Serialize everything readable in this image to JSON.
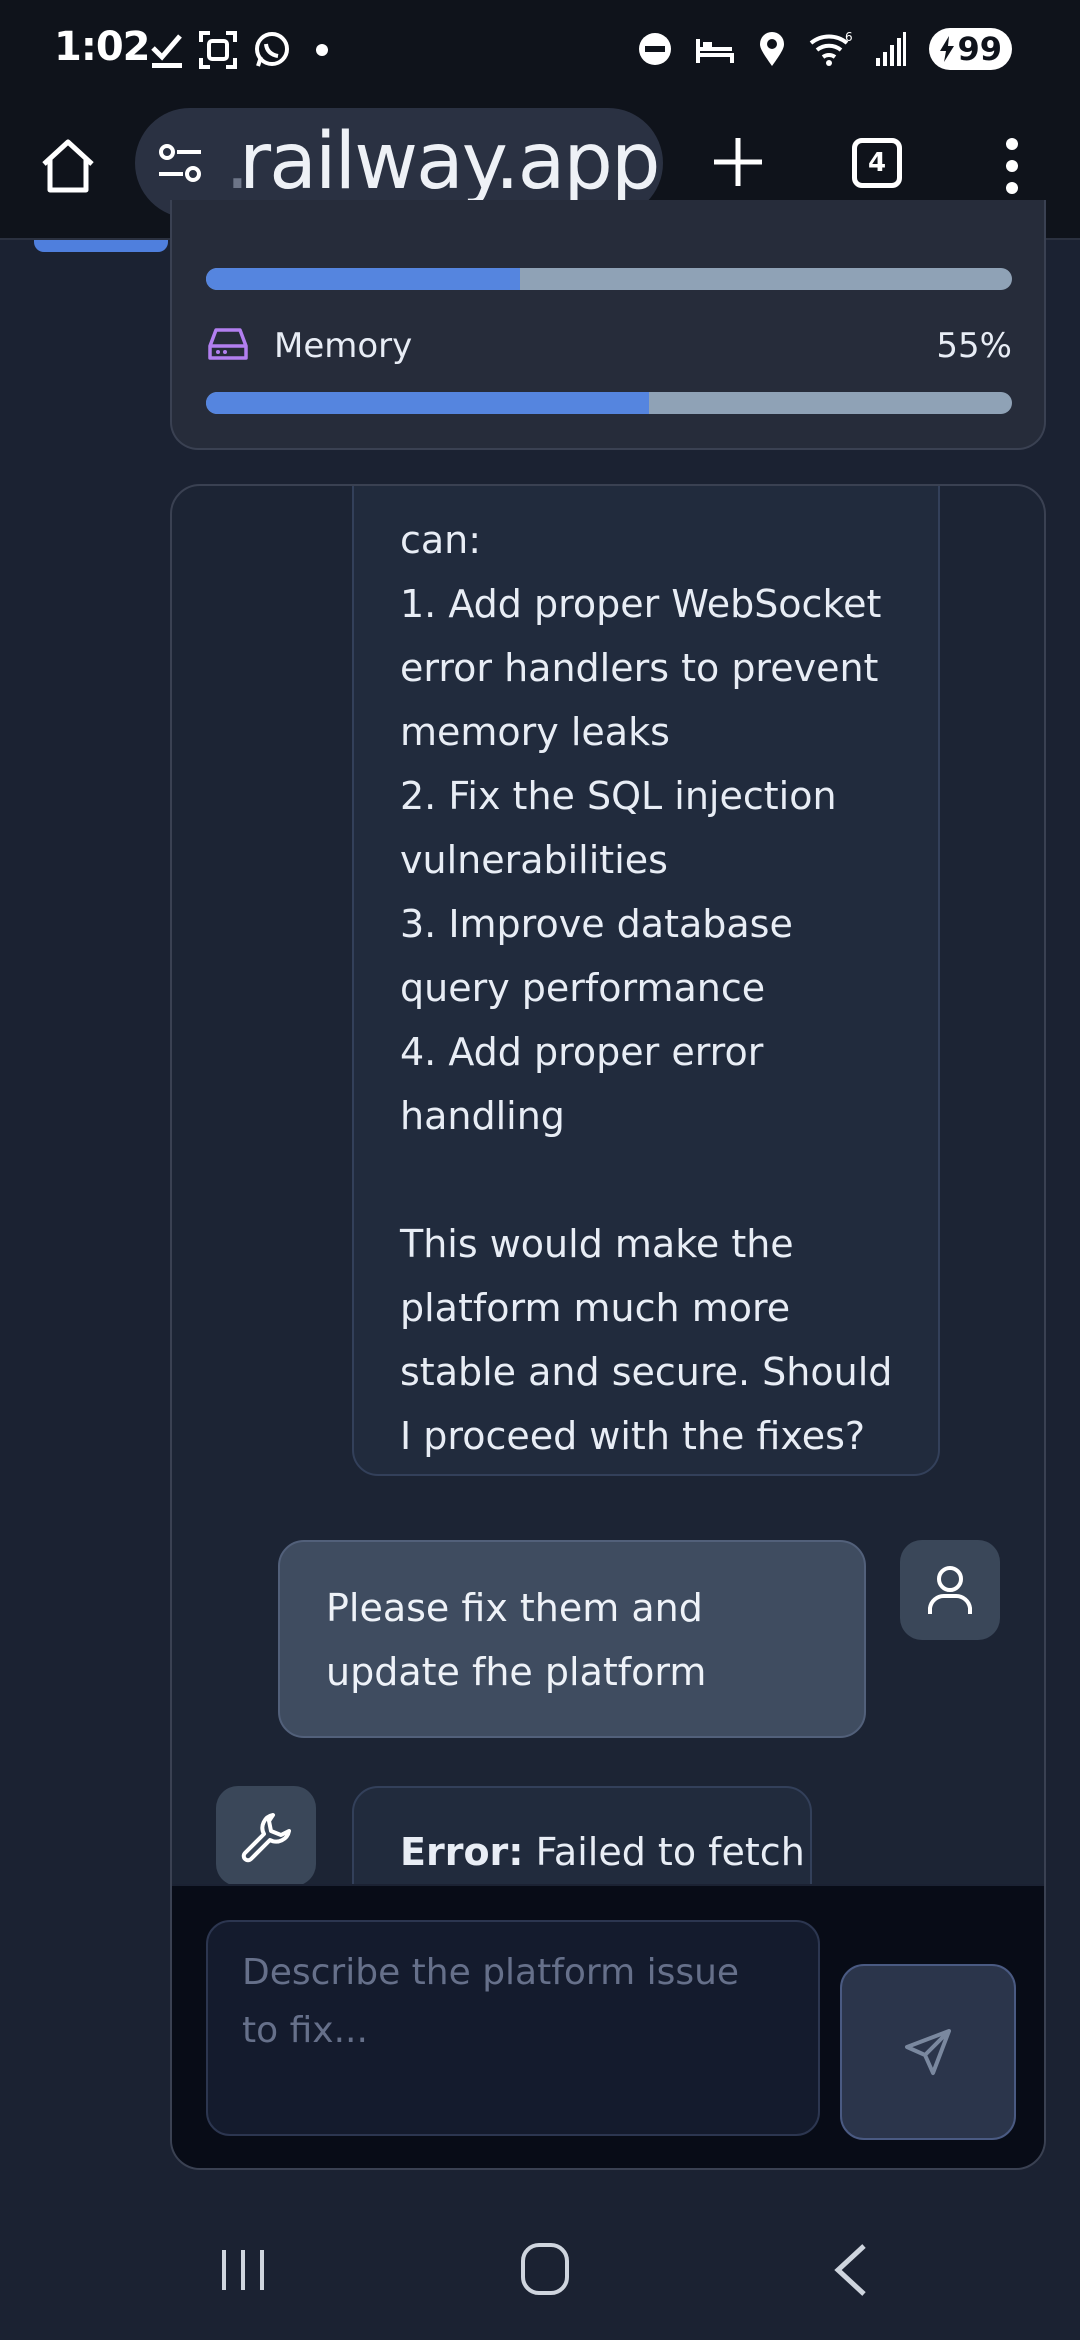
{
  "status_bar": {
    "time": "1:02",
    "battery": "99",
    "icons": [
      "checkmark-icon",
      "screenshot-icon",
      "whatsapp-icon",
      "dnd-icon",
      "sleep-icon",
      "location-icon",
      "wifi-icon",
      "signal-icon"
    ]
  },
  "browser": {
    "url_fade": ".",
    "url": "railway.app",
    "tab_count": "4"
  },
  "resources": {
    "cpu_percent": 39,
    "memory_label": "Memory",
    "memory_value": "55%",
    "memory_percent": 55
  },
  "chat": {
    "messages": [
      {
        "role": "assistant",
        "text": "can:\n1. Add proper WebSocket error handlers to prevent memory leaks\n2. Fix the SQL injection vulnerabilities\n3. Improve database query performance\n4. Add proper error handling\n\nThis would make the platform much more stable and secure. Should I proceed with the fixes?"
      },
      {
        "role": "user",
        "text": "Please fix them and update fhe platform"
      },
      {
        "role": "tool",
        "label": "Error:",
        "text": " Failed to fetch"
      }
    ],
    "input_placeholder": "Describe the platform issue to fix..."
  },
  "colors": {
    "accent": "#5585df",
    "memory_icon": "#b27ff0",
    "background": "#1b2232"
  }
}
